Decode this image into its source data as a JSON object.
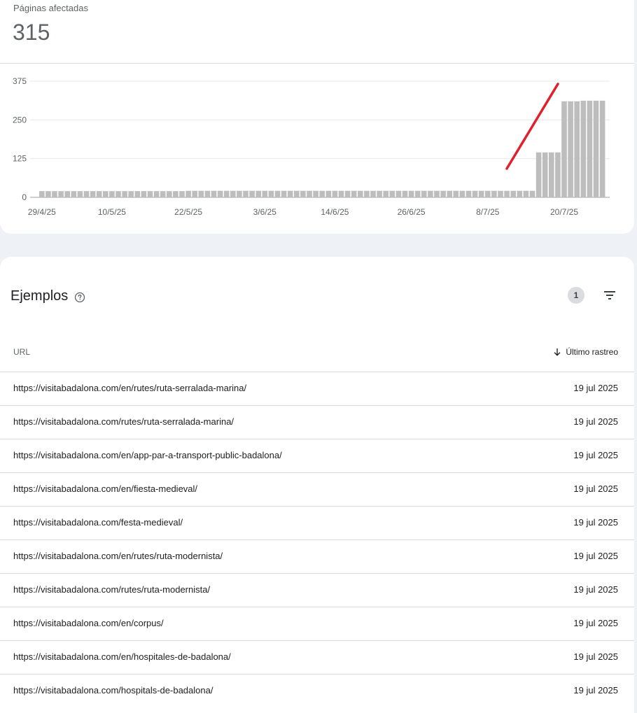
{
  "summary": {
    "label": "Páginas afectadas",
    "value": "315"
  },
  "chart_data": {
    "type": "bar",
    "yticks": [
      "375",
      "250",
      "125",
      "0"
    ],
    "ylim": [
      0,
      375
    ],
    "xlabels": [
      "29/4/25",
      "10/5/25",
      "22/5/25",
      "3/6/25",
      "14/6/25",
      "26/6/25",
      "8/7/25",
      "20/7/25"
    ],
    "x": [
      "29/4/25",
      "30/4/25",
      "1/5/25",
      "2/5/25",
      "3/5/25",
      "4/5/25",
      "5/5/25",
      "6/5/25",
      "7/5/25",
      "8/5/25",
      "9/5/25",
      "10/5/25",
      "11/5/25",
      "12/5/25",
      "13/5/25",
      "14/5/25",
      "15/5/25",
      "16/5/25",
      "17/5/25",
      "18/5/25",
      "19/5/25",
      "20/5/25",
      "21/5/25",
      "22/5/25",
      "23/5/25",
      "24/5/25",
      "25/5/25",
      "26/5/25",
      "27/5/25",
      "28/5/25",
      "29/5/25",
      "30/5/25",
      "31/5/25",
      "1/6/25",
      "2/6/25",
      "3/6/25",
      "4/6/25",
      "5/6/25",
      "6/6/25",
      "7/6/25",
      "8/6/25",
      "9/6/25",
      "10/6/25",
      "11/6/25",
      "12/6/25",
      "13/6/25",
      "14/6/25",
      "15/6/25",
      "16/6/25",
      "17/6/25",
      "18/6/25",
      "19/6/25",
      "20/6/25",
      "21/6/25",
      "22/6/25",
      "23/6/25",
      "24/6/25",
      "25/6/25",
      "26/6/25",
      "27/6/25",
      "28/6/25",
      "29/6/25",
      "30/6/25",
      "1/7/25",
      "2/7/25",
      "3/7/25",
      "4/7/25",
      "5/7/25",
      "6/7/25",
      "7/7/25",
      "8/7/25",
      "9/7/25",
      "10/7/25",
      "11/7/25",
      "12/7/25",
      "13/7/25",
      "14/7/25",
      "15/7/25",
      "16/7/25",
      "17/7/25",
      "18/7/25",
      "19/7/25",
      "20/7/25",
      "21/7/25",
      "22/7/25",
      "23/7/25",
      "24/7/25",
      "25/7/25",
      "26/7/25"
    ],
    "values": [
      20,
      20,
      20,
      20,
      20,
      20,
      20,
      20,
      20,
      20,
      20,
      20,
      20,
      20,
      20,
      20,
      20,
      20,
      20,
      20,
      20,
      20,
      20,
      21,
      21,
      21,
      21,
      21,
      21,
      21,
      21,
      21,
      21,
      21,
      21,
      21,
      21,
      21,
      21,
      21,
      21,
      21,
      21,
      21,
      21,
      21,
      21,
      21,
      21,
      21,
      21,
      21,
      21,
      21,
      21,
      21,
      21,
      21,
      21,
      21,
      21,
      21,
      21,
      21,
      21,
      21,
      21,
      21,
      21,
      21,
      21,
      21,
      21,
      21,
      21,
      21,
      21,
      21,
      145,
      145,
      145,
      145,
      310,
      310,
      310,
      312,
      312,
      312,
      312
    ],
    "grid": true,
    "bar_color": "#bdbdbd",
    "annotation_color": "#e0202a"
  },
  "section": {
    "title": "Ejemplos",
    "help_icon": "help-circle-icon",
    "filter_count": "1",
    "filter_icon": "filter-list-icon"
  },
  "table": {
    "col_url": "URL",
    "col_date": "Último rastreo",
    "sort_icon": "arrow-down-icon",
    "rows": [
      {
        "url": "https://visitabadalona.com/en/rutes/ruta-serralada-marina/",
        "date": "19 jul 2025"
      },
      {
        "url": "https://visitabadalona.com/rutes/ruta-serralada-marina/",
        "date": "19 jul 2025"
      },
      {
        "url": "https://visitabadalona.com/en/app-par-a-transport-public-badalona/",
        "date": "19 jul 2025"
      },
      {
        "url": "https://visitabadalona.com/en/fiesta-medieval/",
        "date": "19 jul 2025"
      },
      {
        "url": "https://visitabadalona.com/festa-medieval/",
        "date": "19 jul 2025"
      },
      {
        "url": "https://visitabadalona.com/en/rutes/ruta-modernista/",
        "date": "19 jul 2025"
      },
      {
        "url": "https://visitabadalona.com/rutes/ruta-modernista/",
        "date": "19 jul 2025"
      },
      {
        "url": "https://visitabadalona.com/en/corpus/",
        "date": "19 jul 2025"
      },
      {
        "url": "https://visitabadalona.com/en/hospitales-de-badalona/",
        "date": "19 jul 2025"
      },
      {
        "url": "https://visitabadalona.com/hospitals-de-badalona/",
        "date": "19 jul 2025"
      }
    ]
  }
}
